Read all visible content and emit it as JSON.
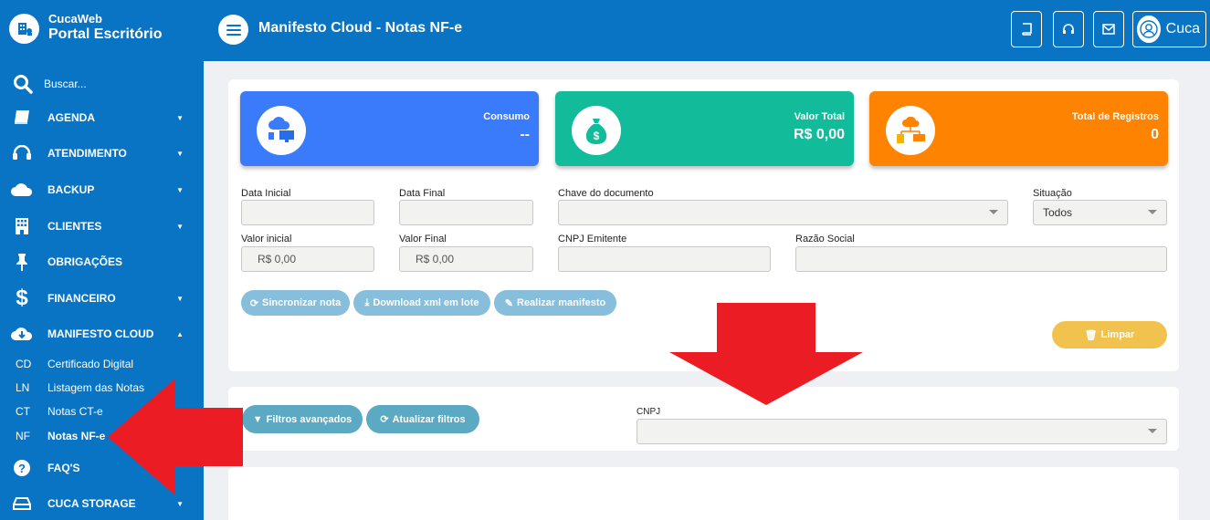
{
  "brand": {
    "small": "CucaWeb",
    "big": "Portal Escritório"
  },
  "header": {
    "title": "Manifesto Cloud - Notas NF-e",
    "user_name": "Cuca"
  },
  "sidebar": {
    "search_label": "Buscar...",
    "items": [
      {
        "label": "AGENDA",
        "icon": "book-icon"
      },
      {
        "label": "ATENDIMENTO",
        "icon": "headset-icon"
      },
      {
        "label": "BACKUP",
        "icon": "cloud-icon"
      },
      {
        "label": "CLIENTES",
        "icon": "building-icon"
      },
      {
        "label": "OBRIGAÇÕES",
        "icon": "pin-icon"
      },
      {
        "label": "FINANCEIRO",
        "icon": "dollar-icon"
      },
      {
        "label": "MANIFESTO CLOUD",
        "icon": "cloud-download-icon"
      },
      {
        "label": "FAQ'S",
        "icon": "question-icon"
      },
      {
        "label": "CUCA STORAGE",
        "icon": "storage-icon"
      }
    ],
    "sub_items": [
      {
        "abbr": "CD",
        "label": "Certificado Digital"
      },
      {
        "abbr": "LN",
        "label": "Listagem das Notas"
      },
      {
        "abbr": "CT",
        "label": "Notas CT-e"
      },
      {
        "abbr": "NF",
        "label": "Notas NF-e"
      }
    ]
  },
  "cards": [
    {
      "label": "Consumo",
      "value": "--",
      "color": "#3a7bfc"
    },
    {
      "label": "Valor Total",
      "value": "R$ 0,00",
      "color": "#12bb9a"
    },
    {
      "label": "Total de Registros",
      "value": "0",
      "color": "#fd8300"
    }
  ],
  "filters": {
    "data_inicial": "Data Inicial",
    "data_final": "Data Final",
    "chave": "Chave do documento",
    "situacao": "Situação",
    "situacao_value": "Todos",
    "valor_inicial": "Valor inicial",
    "valor_inicial_value": "R$ 0,00",
    "valor_final": "Valor Final",
    "valor_final_value": "R$ 0,00",
    "cnpj_emitente": "CNPJ Emitente",
    "razao_social": "Razão Social"
  },
  "actions": {
    "sincronizar": "Sincronizar nota",
    "download": "Download xml em lote",
    "manifesto": "Realizar manifesto",
    "limpar": "Limpar"
  },
  "advanced": {
    "filtros": "Filtros avançados",
    "atualizar": "Atualizar filtros",
    "cnpj_label": "CNPJ"
  },
  "colors": {
    "primary": "#0a74c4",
    "annotation_arrow": "#ec1c24"
  }
}
